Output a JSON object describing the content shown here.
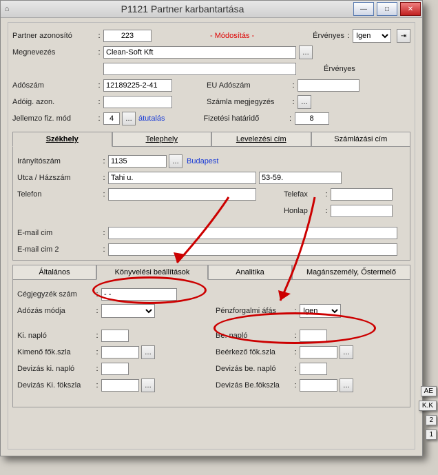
{
  "window": {
    "title": "P1121 Partner karbantartása"
  },
  "header": {
    "partner_id_label": "Partner azonosító",
    "partner_id_value": "223",
    "status": "- Módosítás -",
    "ervenyes_label": "Érvényes",
    "ervenyes_value": "Igen",
    "megnevezes_label": "Megnevezés",
    "megnevezes_value": "Clean-Soft Kft",
    "megnevezes2_value": "",
    "ervenyes_section": "Érvényes",
    "adoszam_label": "Adószám",
    "adoszam_value": "12189225-2-41",
    "eu_adoszam_label": "EU Adószám",
    "eu_adoszam_value": "",
    "adoig_label": "Adóig. azon.",
    "adoig_value": "",
    "szamla_megj_label": "Számla megjegyzés",
    "jell_fiz_label": "Jellemzo fiz. mód",
    "jell_fiz_value": "4",
    "atutalas": "átutalás",
    "fiz_hat_label": "Fizetési határidő",
    "fiz_hat_value": "8"
  },
  "addr_tabs": {
    "t1": "Székhely",
    "t2": "Telephely",
    "t3": "Levelezési cím",
    "t4": "Számlázási cím"
  },
  "address": {
    "irsz_label": "Irányítószám",
    "irsz_value": "1135",
    "city": "Budapest",
    "utca_label": "Utca / Házszám",
    "utca_value": "Tahi u.",
    "hazszam_value": "53-59.",
    "telefon_label": "Telefon",
    "telefon_value": "",
    "telefax_label": "Telefax",
    "honlap_label": "Honlap",
    "email1_label": "E-mail cim",
    "email1_value": "",
    "email2_label": "E-mail cim 2",
    "email2_value": ""
  },
  "bottom_tabs": {
    "t1": "Általános",
    "t2": "Könyvelési beállítások",
    "t3": "Analitika",
    "t4": "Magánszemély, Őstermelő"
  },
  "book": {
    "cegj_label": "Cégjegyzék szám",
    "cegj_value": "- -",
    "adozas_label": "Adózás módja",
    "adozas_value": "",
    "penzforg_label": "Pénzforgalmi áfás",
    "penzforg_value": "Igen",
    "ki_naplo_label": "Ki. napló",
    "be_naplo_label": "Be. napló",
    "kim_fok_label": "Kimenő fők.szla",
    "beerk_fok_label": "Beérkező fők.szla",
    "dev_ki_naplo_label": "Devizás ki. napló",
    "dev_be_naplo_label": "Devizás be. napló",
    "dev_ki_fok_label": "Devizás Ki. fökszla",
    "dev_be_fok_label": "Devizás Be.fökszla"
  },
  "side": {
    "t1": "AE",
    "t2": "K.K",
    "t3": "2",
    "t4": "1"
  }
}
